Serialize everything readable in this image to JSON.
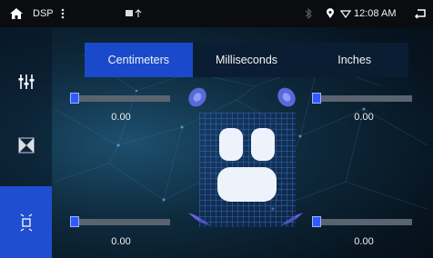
{
  "statusbar": {
    "home_icon": "home-icon",
    "title": "DSP",
    "time": "12:08 AM",
    "colors": {
      "bg": "#0a0c10"
    }
  },
  "tabs": [
    {
      "label": "Centimeters",
      "active": true
    },
    {
      "label": "Milliseconds",
      "active": false
    },
    {
      "label": "Inches",
      "active": false
    }
  ],
  "sliders": {
    "front_left": {
      "value": "0.00",
      "level": 0
    },
    "front_right": {
      "value": "0.00",
      "level": 0
    },
    "rear_left": {
      "value": "0.00",
      "level": 0
    },
    "rear_right": {
      "value": "0.00",
      "level": 0
    }
  },
  "sidebar": {
    "items": [
      {
        "icon": "equalizer-icon",
        "active": false
      },
      {
        "icon": "sound-field-icon",
        "active": false
      },
      {
        "icon": "delay-seat-icon",
        "active": true
      }
    ]
  },
  "colors": {
    "accent": "#1a4acb",
    "handle": "#2e5bff",
    "track": "#5a6470"
  }
}
